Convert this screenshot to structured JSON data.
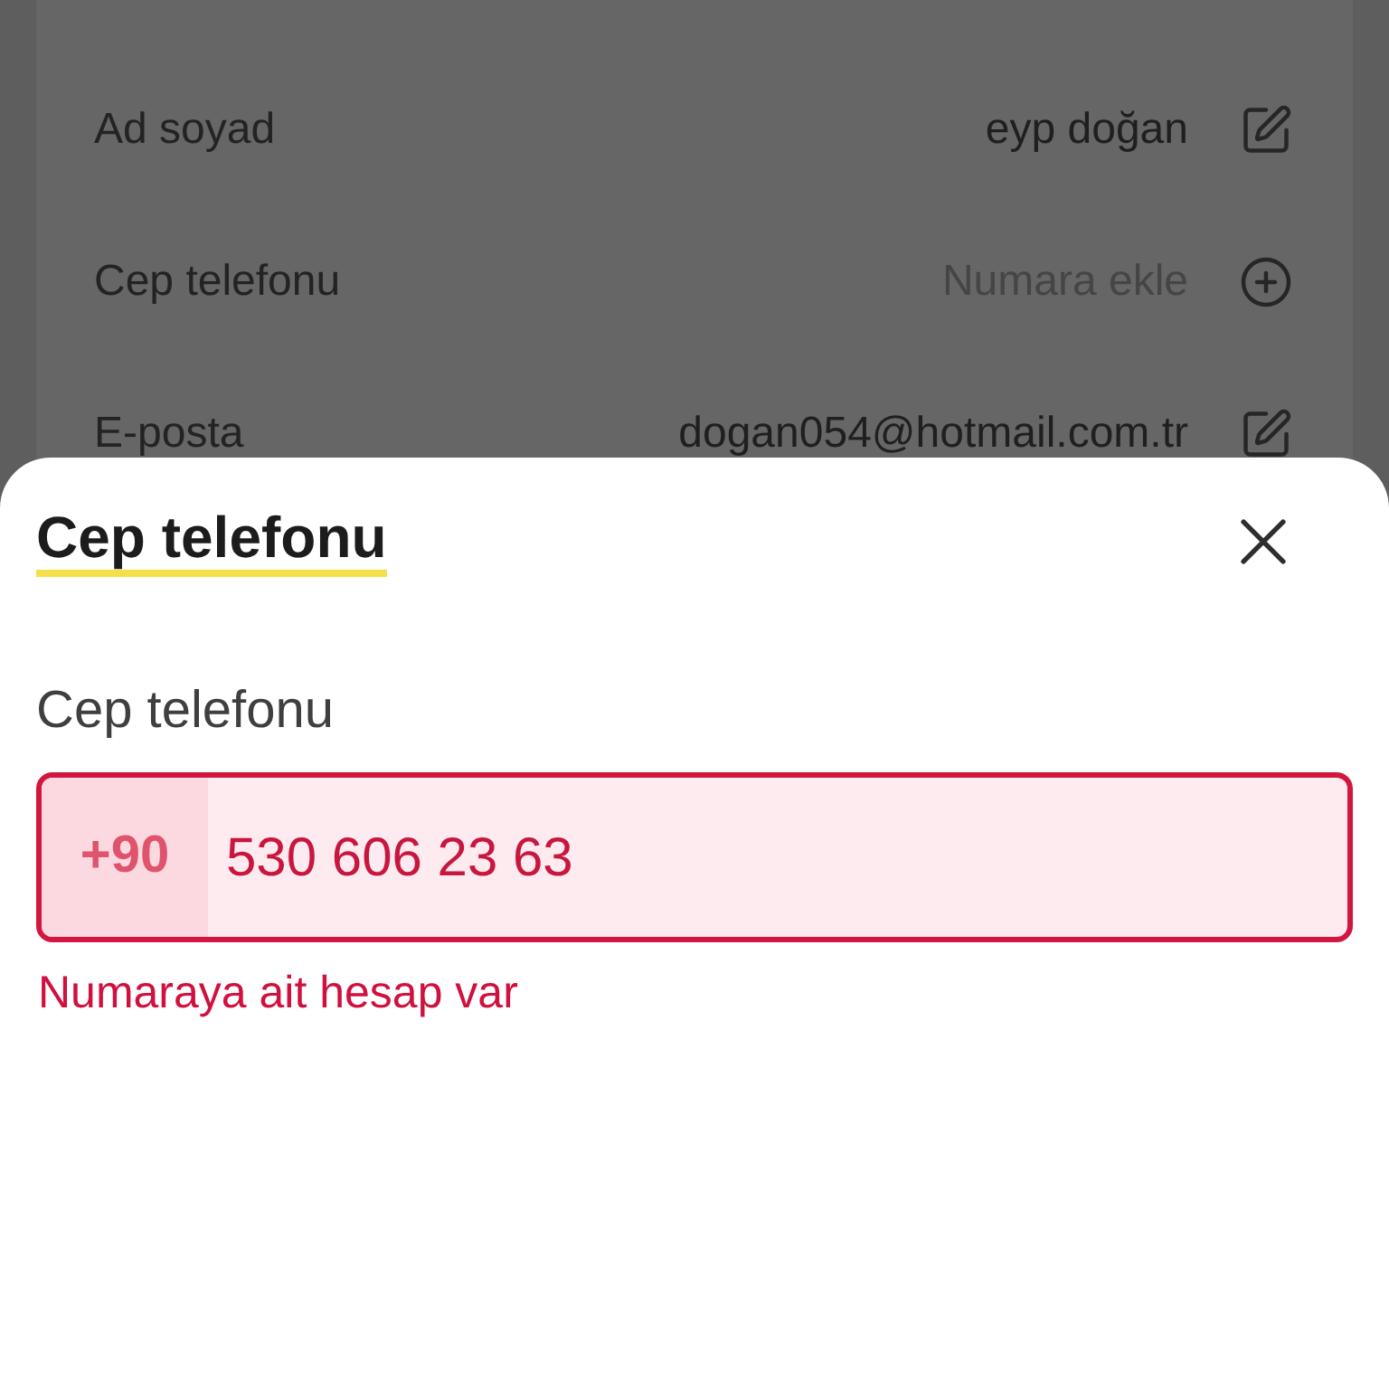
{
  "profile": {
    "rows": [
      {
        "label": "Ad soyad",
        "value": "eyp doğan",
        "empty": false,
        "kind": "edit"
      },
      {
        "label": "Cep telefonu",
        "value": "Numara ekle",
        "empty": true,
        "kind": "add"
      },
      {
        "label": "E-posta",
        "value": "dogan054@hotmail.com.tr",
        "empty": false,
        "kind": "edit"
      }
    ]
  },
  "sheet": {
    "title": "Cep telefonu",
    "field": {
      "label": "Cep telefonu",
      "prefix": "+90",
      "value": "530 606 23 63",
      "invalid": true,
      "error": "Numaraya ait hesap var"
    }
  }
}
